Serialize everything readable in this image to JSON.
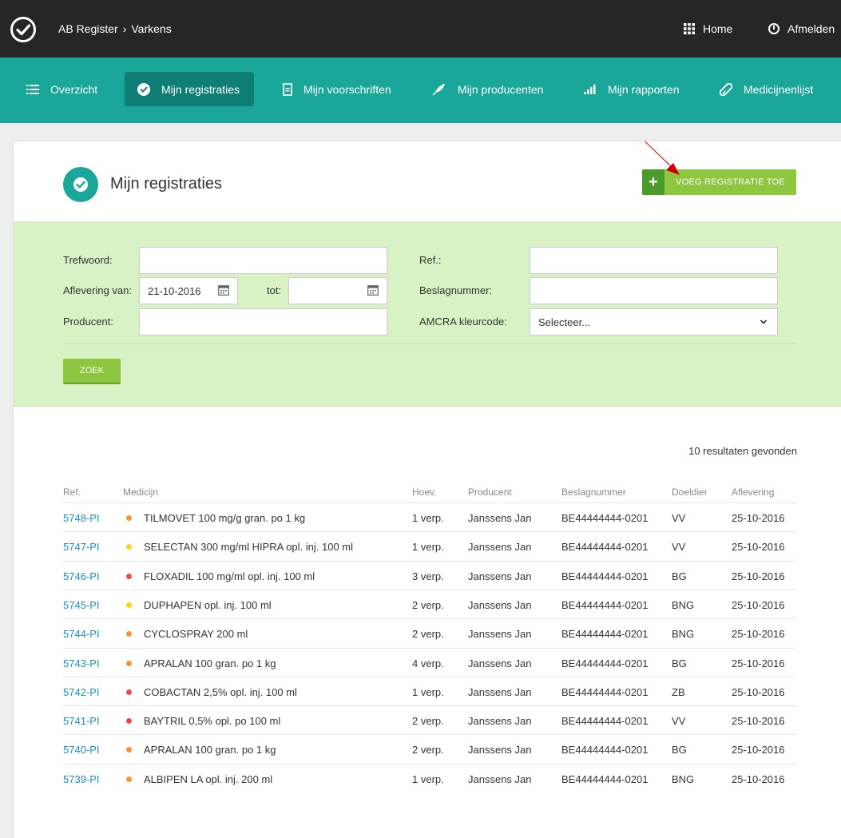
{
  "topbar": {
    "breadcrumb_root": "AB Register",
    "breadcrumb_sep": "›",
    "breadcrumb_current": "Varkens",
    "home_label": "Home",
    "logout_label": "Afmelden"
  },
  "nav": {
    "items": [
      {
        "label": "Overzicht",
        "icon": "list-icon"
      },
      {
        "label": "Mijn registraties",
        "icon": "check-circle-icon",
        "active": true
      },
      {
        "label": "Mijn voorschriften",
        "icon": "document-icon"
      },
      {
        "label": "Mijn producenten",
        "icon": "feather-icon"
      },
      {
        "label": "Mijn rapporten",
        "icon": "bar-chart-icon"
      },
      {
        "label": "Medicijnenlijst",
        "icon": "pill-icon"
      }
    ]
  },
  "page": {
    "title": "Mijn registraties",
    "add_button": "VOEG REGISTRATIE TOE",
    "add_plus": "+"
  },
  "filters": {
    "trefwoord_label": "Trefwoord:",
    "trefwoord_value": "",
    "aflevering_label": "Aflevering van:",
    "aflevering_from": "21-10-2016",
    "tot_label": "tot:",
    "aflevering_to": "",
    "producent_label": "Producent:",
    "producent_value": "",
    "ref_label": "Ref.:",
    "ref_value": "",
    "beslag_label": "Beslagnummer:",
    "beslag_value": "",
    "amcra_label": "AMCRA kleurcode:",
    "amcra_value": "Selecteer...",
    "search_button": "ZOEK"
  },
  "results": {
    "count_text": "10 resultaten gevonden",
    "headers": [
      "Ref.",
      "Medicijn",
      "Hoev.",
      "Producent",
      "Beslagnummer",
      "Doeldier",
      "Aflevering"
    ],
    "rows": [
      {
        "ref": "5748-PI",
        "color": "#f39540",
        "medicijn": "TILMOVET 100 mg/g gran. po 1 kg",
        "hoev": "1 verp.",
        "producent": "Janssens Jan",
        "beslag": "BE44444444-0201",
        "doeldier": "VV",
        "aflevering": "25-10-2016"
      },
      {
        "ref": "5747-PI",
        "color": "#f7d31a",
        "medicijn": "SELECTAN 300 mg/ml HIPRA opl. inj. 100 ml",
        "hoev": "1 verp.",
        "producent": "Janssens Jan",
        "beslag": "BE44444444-0201",
        "doeldier": "VV",
        "aflevering": "25-10-2016"
      },
      {
        "ref": "5746-PI",
        "color": "#ec4b4b",
        "medicijn": "FLOXADIL 100 mg/ml opl. inj. 100 ml",
        "hoev": "3 verp.",
        "producent": "Janssens Jan",
        "beslag": "BE44444444-0201",
        "doeldier": "BG",
        "aflevering": "25-10-2016"
      },
      {
        "ref": "5745-PI",
        "color": "#f7d31a",
        "medicijn": "DUPHAPEN opl. inj. 100 ml",
        "hoev": "2 verp.",
        "producent": "Janssens Jan",
        "beslag": "BE44444444-0201",
        "doeldier": "BNG",
        "aflevering": "25-10-2016"
      },
      {
        "ref": "5744-PI",
        "color": "#f39540",
        "medicijn": "CYCLOSPRAY 200 ml",
        "hoev": "2 verp.",
        "producent": "Janssens Jan",
        "beslag": "BE44444444-0201",
        "doeldier": "BNG",
        "aflevering": "25-10-2016"
      },
      {
        "ref": "5743-PI",
        "color": "#f39540",
        "medicijn": "APRALAN 100 gran. po 1 kg",
        "hoev": "4 verp.",
        "producent": "Janssens Jan",
        "beslag": "BE44444444-0201",
        "doeldier": "BG",
        "aflevering": "25-10-2016"
      },
      {
        "ref": "5742-PI",
        "color": "#ec4b4b",
        "medicijn": "COBACTAN 2,5% opl. inj. 100 ml",
        "hoev": "1 verp.",
        "producent": "Janssens Jan",
        "beslag": "BE44444444-0201",
        "doeldier": "ZB",
        "aflevering": "25-10-2016"
      },
      {
        "ref": "5741-PI",
        "color": "#ec4b4b",
        "medicijn": "BAYTRIL 0,5% opl. po 100 ml",
        "hoev": "2 verp.",
        "producent": "Janssens Jan",
        "beslag": "BE44444444-0201",
        "doeldier": "VV",
        "aflevering": "25-10-2016"
      },
      {
        "ref": "5740-PI",
        "color": "#f39540",
        "medicijn": "APRALAN 100 gran. po 1 kg",
        "hoev": "2 verp.",
        "producent": "Janssens Jan",
        "beslag": "BE44444444-0201",
        "doeldier": "BG",
        "aflevering": "25-10-2016"
      },
      {
        "ref": "5739-PI",
        "color": "#f39540",
        "medicijn": "ALBIPEN LA opl. inj. 200 ml",
        "hoev": "1 verp.",
        "producent": "Janssens Jan",
        "beslag": "BE44444444-0201",
        "doeldier": "BNG",
        "aflevering": "25-10-2016"
      }
    ]
  },
  "colors": {
    "topbar": "#262626",
    "nav": "#1aa79a",
    "nav_active": "#0f7f75",
    "filter_bg": "#d9f2c5",
    "button_green": "#8dc63f",
    "link_blue": "#1a8fc8",
    "annotation_arrow": "#cc0000"
  }
}
